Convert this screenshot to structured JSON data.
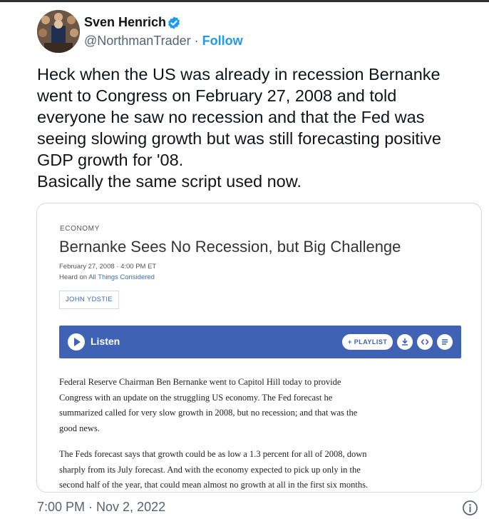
{
  "tweet": {
    "author_name": "Sven Henrich",
    "handle": "@NorthmanTrader",
    "separator": " · ",
    "follow_label": "Follow",
    "text_lines": [
      "Heck when the US was already in recession Bernanke",
      "went to Congress on February 27, 2008 and told",
      "everyone he saw no recession and that the Fed was",
      "seeing slowing growth but was still forecasting positive",
      "GDP growth for '08.",
      "Basically the same script used now."
    ],
    "timestamp": "7:00 PM · Nov 2, 2022"
  },
  "card": {
    "kicker": "ECONOMY",
    "headline": "Bernanke Sees No Recession, but Big Challenge",
    "dateline": "February 27, 2008 · 4:00 PM ET",
    "heard_prefix": "Heard on ",
    "heard_show": "All Things Considered",
    "byline": "JOHN YDSTIE",
    "player": {
      "listen_label": "Listen",
      "playlist_label": "+ PLAYLIST"
    },
    "paragraph1": [
      "Federal Reserve Chairman Ben Bernanke went to Capitol Hill today to provide",
      "Congress with an update on the struggling US economy. The Fed forecast he",
      "summarized called for very slow growth in 2008, but no recession; and that was the",
      "good news."
    ],
    "paragraph2": [
      "The Feds forecast says that growth could be as low a 1.3 percent for all of 2008, down",
      "sharply from its July forecast. And with the economy expected to pick up only in the",
      "second half of the year, that could mean almost no growth at all in the first six months."
    ]
  },
  "colors": {
    "accent": "#1d9bf0",
    "player_bg": "#3f62b5",
    "text": "#0f1419",
    "muted": "#536471"
  }
}
